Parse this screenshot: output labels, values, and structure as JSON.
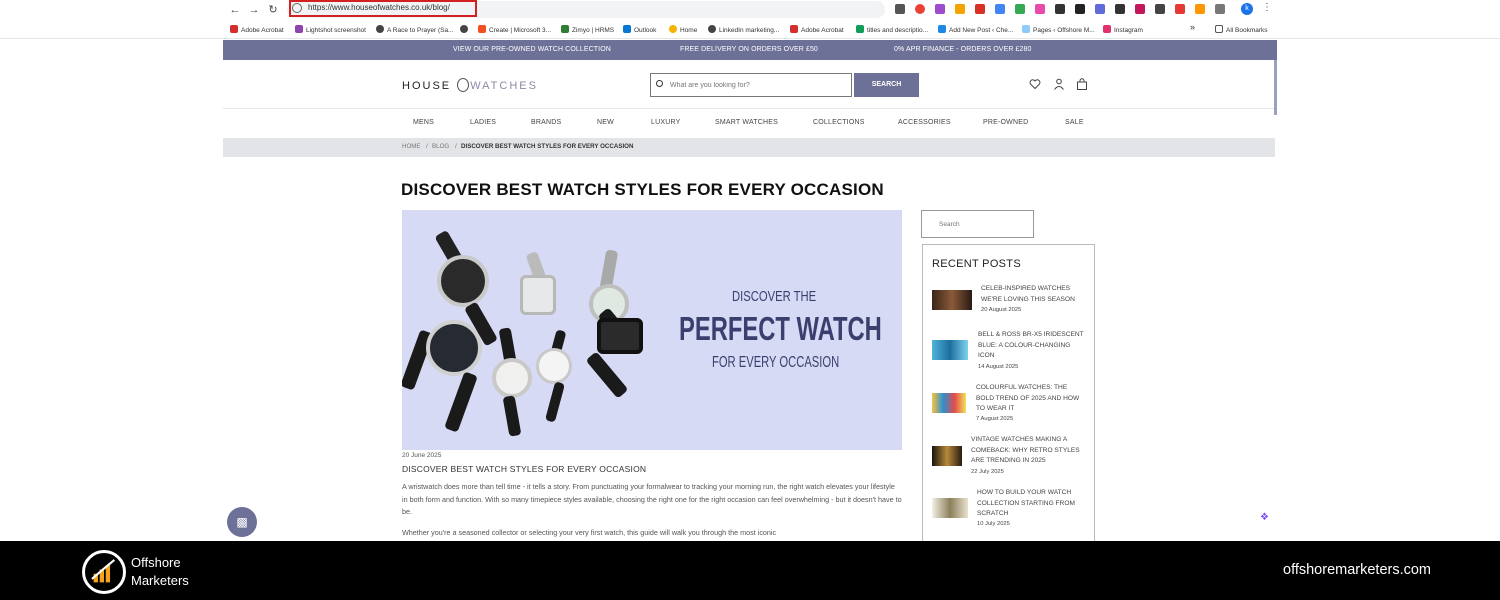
{
  "browser": {
    "url": "https://www.houseofwatches.co.uk/blog/",
    "profile_initial": "k",
    "bookmarks": [
      "Adobe Acrobat",
      "Lightshot screenshot",
      "A Race to Prayer (Sa...",
      "Create | Microsoft 3...",
      "Zimyo | HRMS",
      "Outlook",
      "Home",
      "LinkedIn marketing...",
      "Adobe Acrobat",
      "titles and descriptio...",
      "Add New Post ‹ Che...",
      "Pages ‹ Offshore M...",
      "Instagram"
    ],
    "more_bookmarks": "»",
    "all_bookmarks": "All Bookmarks"
  },
  "promo": {
    "left": "VIEW OUR PRE-OWNED WATCH COLLECTION",
    "center": "FREE DELIVERY ON ORDERS OVER £50",
    "right": "0% APR FINANCE - ORDERS OVER £280"
  },
  "header": {
    "logo_a": "HOUSE",
    "logo_b": "WATCHES",
    "search_placeholder": "What are you looking for?",
    "search_button": "SEARCH"
  },
  "menu": [
    "MENS",
    "LADIES",
    "BRANDS",
    "NEW",
    "LUXURY",
    "SMART WATCHES",
    "COLLECTIONS",
    "ACCESSORIES",
    "PRE-OWNED",
    "SALE"
  ],
  "breadcrumb": {
    "home": "HOME",
    "sep1": "/",
    "blog": "BLOG",
    "sep2": "/",
    "current": "DISCOVER BEST WATCH STYLES FOR EVERY OCCASION"
  },
  "post": {
    "title": "DISCOVER BEST WATCH STYLES FOR EVERY OCCASION",
    "hero_line1": "DISCOVER THE",
    "hero_line2": "PERFECT WATCH",
    "hero_line3": "FOR EVERY OCCASION",
    "date": "20 June 2025",
    "heading": "DISCOVER BEST WATCH STYLES FOR EVERY OCCASION",
    "para1": "A wristwatch does more than tell time - it tells a story. From punctuating your formalwear to tracking your morning run, the right watch elevates your lifestyle in both form and function. With so many timepiece styles available, choosing the right one for the right occasion can feel overwhelming - but it doesn't have to be.",
    "para2": "Whether you're a seasoned collector or selecting your very first watch, this guide will walk you through the most iconic"
  },
  "sidebar": {
    "search_placeholder": "Search",
    "recent_title": "RECENT POSTS",
    "posts": [
      {
        "title": "CELEB-INSPIRED WATCHES WE'RE LOVING THIS SEASON",
        "date": "20 August 2025"
      },
      {
        "title": "BELL & ROSS BR-X5 IRIDESCENT BLUE: A COLOUR-CHANGING ICON",
        "date": "14 August 2025"
      },
      {
        "title": "COLOURFUL WATCHES: THE BOLD TREND OF 2025 AND HOW TO WEAR IT",
        "date": "7 August 2025"
      },
      {
        "title": "VINTAGE WATCHES MAKING A COMEBACK: WHY RETRO STYLES ARE TRENDING IN 2025",
        "date": "22 July 2025"
      },
      {
        "title": "HOW TO BUILD YOUR WATCH COLLECTION STARTING FROM SCRATCH",
        "date": "10 July 2025"
      }
    ]
  },
  "branding": {
    "name_line1": "Offshore",
    "name_line2": "Marketers",
    "website": "offshoremarketers.com"
  },
  "colors": {
    "accent": "#6e7197",
    "footer": "#000000",
    "url_highlight": "#d32020"
  },
  "icons": {
    "back": "back-arrow-icon",
    "forward": "forward-arrow-icon",
    "reload": "reload-icon",
    "wishlist": "heart-icon",
    "account": "user-icon",
    "bag": "shopping-bag-icon",
    "chat": "chat-icon"
  }
}
